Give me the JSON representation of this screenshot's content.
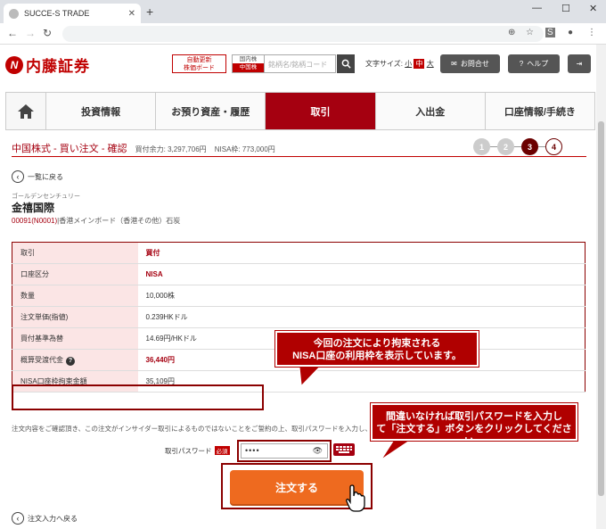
{
  "browser": {
    "tab_title": "SUCCE-S TRADE"
  },
  "header": {
    "logo_text": "内藤証券",
    "auto_update": "自動更新\n株価ボード",
    "market_top": "国内株",
    "market_bottom": "中国株",
    "search_placeholder": "銘柄名/銘柄コード",
    "font_size_label": "文字サイズ:",
    "font_small": "小",
    "font_mid": "中",
    "font_large": "大",
    "contact": "お問合せ",
    "help": "ヘルプ"
  },
  "nav": {
    "items": [
      "投資情報",
      "お預り資産・履歴",
      "取引",
      "入出金",
      "口座情報/手続き"
    ]
  },
  "page": {
    "title": "中国株式 - 買い注文 - 確認",
    "buying_power": "買付余力: 3,297,706円",
    "nisa": "NISA枠: 773,000円",
    "steps": [
      "1",
      "2",
      "3",
      "4"
    ],
    "back_list": "一覧に戻る",
    "stock_kana": "ゴールデンセンチュリー",
    "stock_name": "金禧国際",
    "stock_code": "00091(N0001)",
    "stock_market": "|香港メインボード（香港その他）石炭"
  },
  "order_table": [
    {
      "label": "取引",
      "value": "買付"
    },
    {
      "label": "口座区分",
      "value": "NISA"
    },
    {
      "label": "数量",
      "value": "10,000株"
    },
    {
      "label": "注文単価(指値)",
      "value": "0.239HKドル"
    },
    {
      "label": "買付基準為替",
      "value": "14.69円/HKドル"
    },
    {
      "label": "概算受渡代金",
      "value": "36,440円"
    },
    {
      "label": "NISA口座枠拘束金額",
      "value": "35,109円"
    }
  ],
  "callouts": {
    "c1_line1": "今回の注文により拘束される",
    "c1_line2": "NISA口座の利用枠を表示しています。",
    "c2_line1": "間違いなければ取引パスワードを入力し",
    "c2_line2": "て「注文する」ボタンをクリックしてください。"
  },
  "form": {
    "notice": "注文内容をご確認頂き、この注文がインサイダー取引によるものではないことをご誓約の上、取引パスワードを入力し、",
    "password_label": "取引パスワード",
    "required": "必須",
    "password_value": "••••",
    "submit": "注文する",
    "back_input": "注文入力へ戻る"
  }
}
